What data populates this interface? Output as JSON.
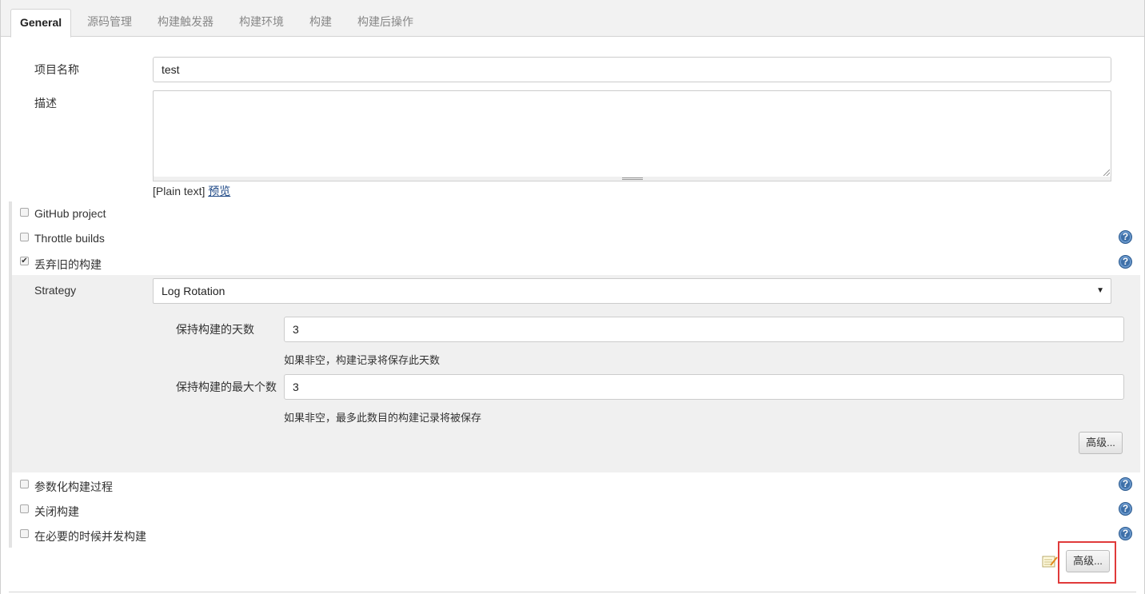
{
  "tabs": [
    {
      "label": "General"
    },
    {
      "label": "源码管理"
    },
    {
      "label": "构建触发器"
    },
    {
      "label": "构建环境"
    },
    {
      "label": "构建"
    },
    {
      "label": "构建后操作"
    }
  ],
  "project_name": {
    "label": "项目名称",
    "value": "test"
  },
  "description": {
    "label": "描述",
    "value": "",
    "format": "[Plain text]",
    "preview_link": "预览"
  },
  "options": {
    "github_project": {
      "label": "GitHub project",
      "checked": false
    },
    "throttle_builds": {
      "label": "Throttle builds",
      "checked": false
    },
    "discard_old_builds": {
      "label": "丢弃旧的构建",
      "checked": true
    }
  },
  "strategy": {
    "label": "Strategy",
    "selected": "Log Rotation",
    "days_to_keep": {
      "label": "保持构建的天数",
      "value": "3",
      "hint": "如果非空，构建记录将保存此天数"
    },
    "max_builds": {
      "label": "保持构建的最大个数",
      "value": "3",
      "hint": "如果非空，最多此数目的构建记录将被保存"
    },
    "advanced_label": "高级..."
  },
  "more_options": {
    "parameterized": {
      "label": "参数化构建过程",
      "checked": false
    },
    "disable_build": {
      "label": "关闭构建",
      "checked": false
    },
    "concurrent_build": {
      "label": "在必要的时候并发构建",
      "checked": false
    }
  },
  "advanced_button_label": "高级...",
  "help_glyph": "?",
  "check_glyph": "✔",
  "colors": {
    "help_icon": "#3d6fa8",
    "highlight_box": "#e03a3a",
    "link": "#204a87"
  }
}
